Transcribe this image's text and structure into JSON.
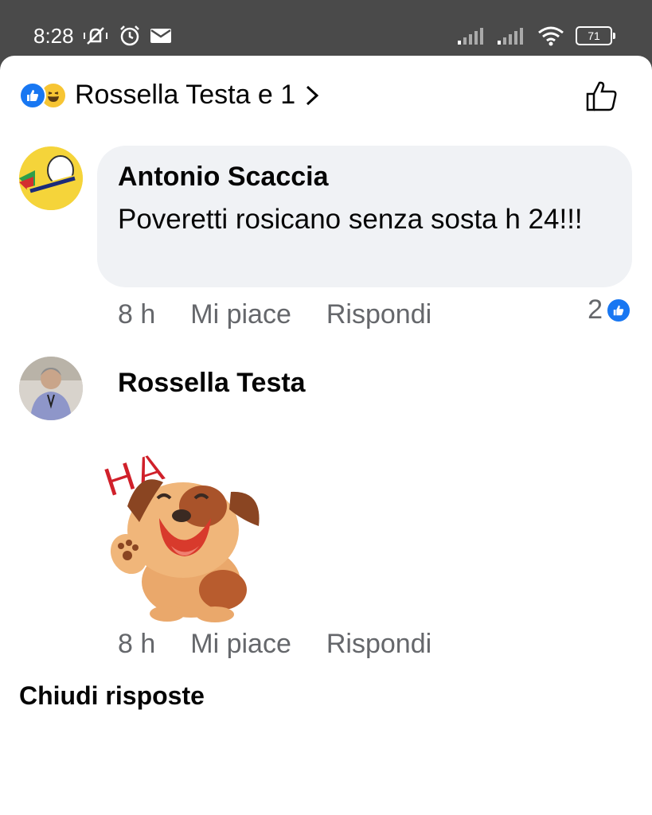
{
  "status_bar": {
    "time": "8:28",
    "battery": "71"
  },
  "header": {
    "title": "Rossella Testa e 1",
    "reactions": [
      "like-icon",
      "haha-icon"
    ]
  },
  "comments": [
    {
      "author": "Antonio Scaccia",
      "text": "Poveretti rosicano senza sosta h 24!!!",
      "time": "8 h",
      "like_label": "Mi piace",
      "reply_label": "Rispondi",
      "reaction_count": "2"
    },
    {
      "author": "Rossella Testa",
      "sticker": "laughing-dog-sticker",
      "sticker_text": "HA",
      "time": "8 h",
      "like_label": "Mi piace",
      "reply_label": "Rispondi"
    }
  ],
  "close_replies": "Chiudi risposte",
  "colors": {
    "accent": "#1877f2",
    "bubble": "#f0f2f5",
    "secondary_text": "#65676b"
  }
}
